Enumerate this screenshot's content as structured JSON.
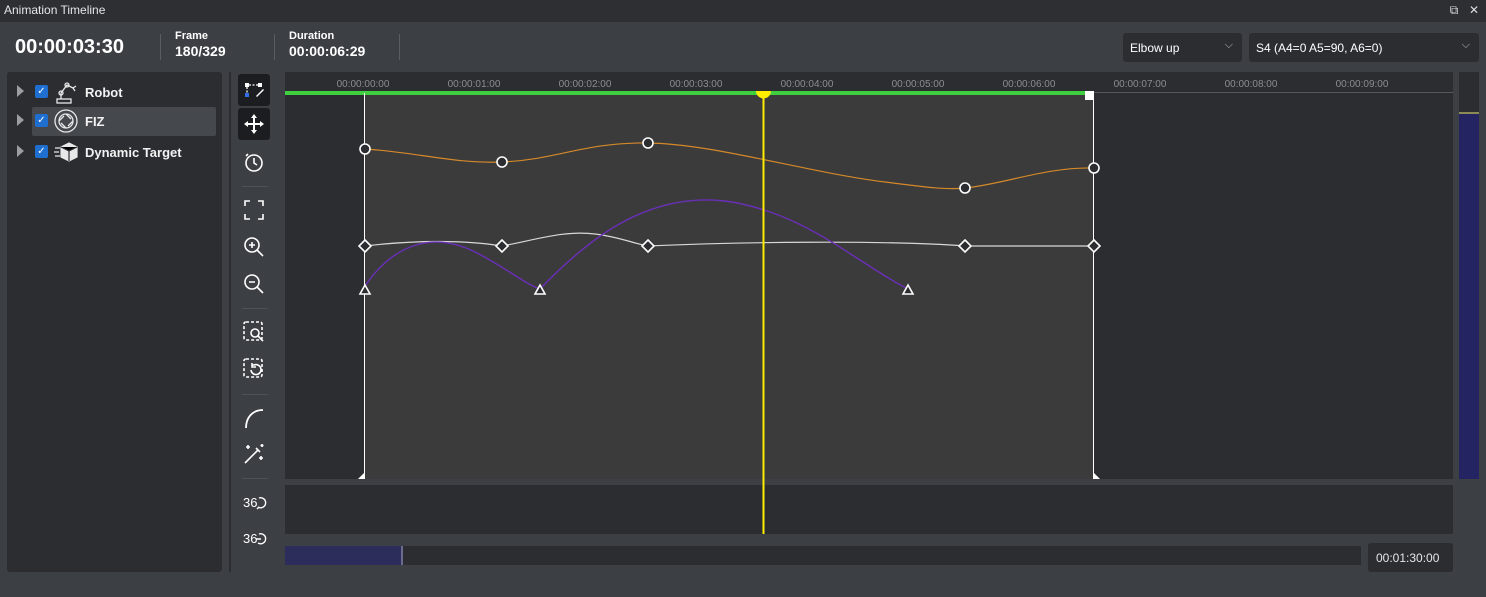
{
  "window": {
    "title": "Animation Timeline",
    "restore_icon": "restore-icon",
    "close_icon": "close-icon"
  },
  "info": {
    "current_time": "00:00:03:30",
    "frame_label": "Frame",
    "frame_value": "180/329",
    "duration_label": "Duration",
    "duration_value": "00:00:06:29"
  },
  "dropdowns": {
    "configuration": "Elbow up",
    "solution": "S4 (A4=0 A5=90, A6=0)"
  },
  "tree": {
    "items": [
      {
        "label": "Robot",
        "icon": "robot-arm-icon",
        "checked": true
      },
      {
        "label": "FIZ",
        "icon": "lens-aperture-icon",
        "checked": true,
        "selected": true
      },
      {
        "label": "Dynamic Target",
        "icon": "moving-cube-icon",
        "checked": true
      }
    ]
  },
  "toolbar": {
    "tools": [
      "curve-edit-icon",
      "move-icon",
      "clock-icon",
      "fit-all-icon",
      "zoom-in-icon",
      "zoom-out-icon",
      "zoom-region-icon",
      "reset-region-icon",
      "ease-curve-icon",
      "magic-wand-icon",
      "rotate-360-icon",
      "rotate-360-alt-icon"
    ]
  },
  "ruler": {
    "labels": [
      "00:00:00:00",
      "00:00:01:00",
      "00:00:02:00",
      "00:00:03:00",
      "00:00:04:00",
      "00:00:05:00",
      "00:00:06:00",
      "00:00:07:00",
      "00:00:08:00",
      "00:00:09:00"
    ]
  },
  "scroll": {
    "end_time": "00:01:30:00",
    "thumb_fraction": 0.11
  },
  "colors": {
    "playhead": "#ffee00",
    "range_bar": "#3fcf3f",
    "curve_orange": "#d4882a",
    "curve_white": "#d8d8d8",
    "curve_purple": "#6a2fb8",
    "checkbox": "#1f6fd1"
  }
}
